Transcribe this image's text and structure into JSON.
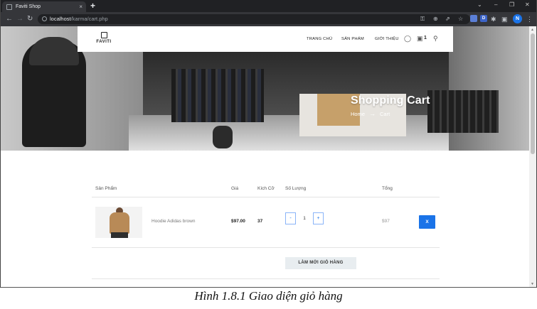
{
  "browser": {
    "tab_title": "Faviti Shop",
    "tab_close": "×",
    "new_tab": "+",
    "url_host": "localhost",
    "url_path": "/karma/cart.php",
    "profile_initial": "N",
    "ext_d": "D",
    "window_minimize": "⌄",
    "window_min": "–",
    "window_restore": "❐",
    "window_close": "✕"
  },
  "site": {
    "logo_text": "FAVITI",
    "nav": [
      "TRANG CHỦ",
      "SẢN PHẨM",
      "GIỚI THIỆU"
    ],
    "cart_count": "1"
  },
  "hero": {
    "title": "Shopping Cart",
    "breadcrumb": [
      "Home",
      "Cart"
    ],
    "breadcrumb_arrow": "→"
  },
  "cart": {
    "headers": {
      "product": "Sản Phẩm",
      "price": "Giá",
      "size": "Kích Cỡ",
      "quantity": "Số Lượng",
      "total": "Tổng"
    },
    "items": [
      {
        "name": "Hoodie Adidas brown",
        "price": "$97.00",
        "size": "37",
        "quantity": "1",
        "total": "$97",
        "remove_label": "X"
      }
    ],
    "qty_minus": "-",
    "qty_plus": "+",
    "update_label": "LÀM MỚI GIỎ HÀNG"
  },
  "caption": "Hình 1.8.1 Giao diện giỏ hàng"
}
